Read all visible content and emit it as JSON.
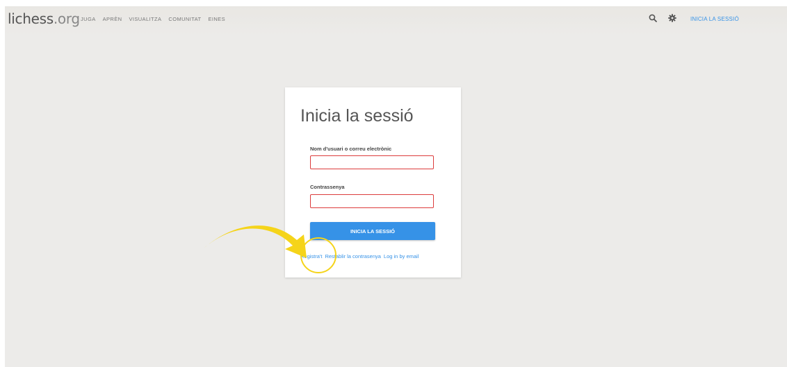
{
  "header": {
    "logo_main": "lichess",
    "logo_tld": ".org",
    "nav": [
      "JUGA",
      "APRÈN",
      "VISUALITZA",
      "COMUNITAT",
      "EINES"
    ],
    "search_icon": "search-icon",
    "settings_icon": "gear-icon",
    "signin_label": "INICIA LA SESSIÓ"
  },
  "login": {
    "title": "Inicia la sessió",
    "username_label": "Nom d'usuari o correu electrònic",
    "username_value": "",
    "password_label": "Contrassenya",
    "password_value": "",
    "submit_label": "INICIA LA SESSIÓ",
    "links": {
      "register": "Registra't",
      "reset": "Restablir la contrasenya",
      "email": "Log in by email"
    }
  },
  "annotation": {
    "arrow_color": "#f5d41a",
    "circle_color": "#f5d41a"
  },
  "colors": {
    "accent": "#3692e7",
    "field_error": "#dc3b3b",
    "background": "#ecebe9"
  }
}
